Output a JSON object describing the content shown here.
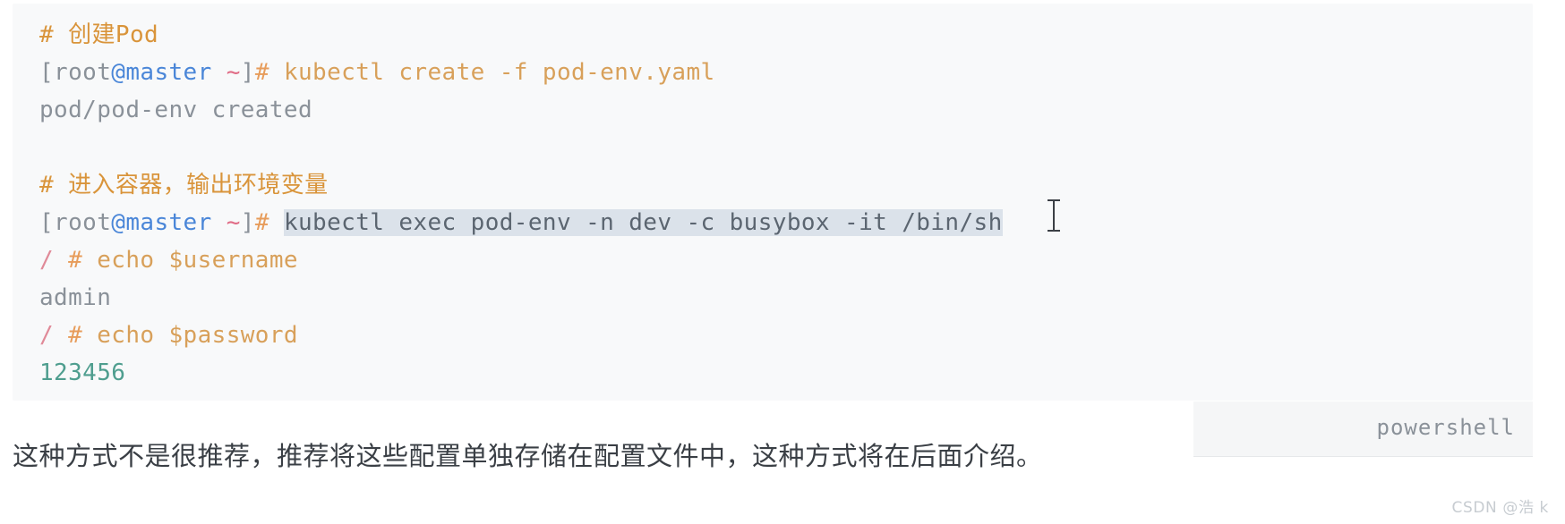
{
  "code_block": {
    "language_label": "powershell",
    "lines": [
      {
        "id": "comment-create-pod",
        "tokens": [
          {
            "kind": "comment",
            "text": "# 创建Pod"
          }
        ]
      },
      {
        "id": "cmd-create",
        "tokens": [
          {
            "kind": "bracket",
            "text": "[root"
          },
          {
            "kind": "host",
            "text": "@master"
          },
          {
            "kind": "bracket",
            "text": " "
          },
          {
            "kind": "tilde",
            "text": "~"
          },
          {
            "kind": "bracket",
            "text": "]"
          },
          {
            "kind": "hash",
            "text": "# "
          },
          {
            "kind": "cmd",
            "text": "kubectl create -f pod-env.yaml"
          }
        ]
      },
      {
        "id": "out-created",
        "tokens": [
          {
            "kind": "out",
            "text": "pod/pod-env created"
          }
        ]
      },
      {
        "id": "blank-1",
        "tokens": []
      },
      {
        "id": "comment-enter-container",
        "tokens": [
          {
            "kind": "comment",
            "text": "# 进入容器，输出环境变量"
          }
        ]
      },
      {
        "id": "cmd-exec",
        "tokens": [
          {
            "kind": "bracket",
            "text": "[root"
          },
          {
            "kind": "host",
            "text": "@master"
          },
          {
            "kind": "bracket",
            "text": " "
          },
          {
            "kind": "tilde",
            "text": "~"
          },
          {
            "kind": "bracket",
            "text": "]"
          },
          {
            "kind": "hash",
            "text": "# "
          },
          {
            "kind": "selected",
            "text": "kubectl exec pod-env -n dev -c busybox -it /bin/sh"
          }
        ]
      },
      {
        "id": "cmd-echo-username",
        "tokens": [
          {
            "kind": "slash",
            "text": "/ "
          },
          {
            "kind": "hash",
            "text": "# "
          },
          {
            "kind": "cmd",
            "text": "echo $username"
          }
        ]
      },
      {
        "id": "out-admin",
        "tokens": [
          {
            "kind": "out",
            "text": "admin"
          }
        ]
      },
      {
        "id": "cmd-echo-password",
        "tokens": [
          {
            "kind": "slash",
            "text": "/ "
          },
          {
            "kind": "hash",
            "text": "# "
          },
          {
            "kind": "cmd",
            "text": "echo $password"
          }
        ]
      },
      {
        "id": "out-123456",
        "tokens": [
          {
            "kind": "num",
            "text": "123456"
          }
        ]
      }
    ]
  },
  "paragraph": {
    "text": "这种方式不是很推荐，推荐将这些配置单独存储在配置文件中，这种方式将在后面介绍。"
  },
  "watermark": {
    "text": "CSDN @浩 k"
  },
  "colors": {
    "code_background": "#f8f9fa",
    "selection_background": "#dbe2ea",
    "comment": "#d9943a",
    "host": "#4a86d8",
    "command": "#d8a05a",
    "output": "#8a9199",
    "number": "#4f9e8f",
    "paragraph_text": "#3a3f45",
    "watermark": "#c7ccd1"
  }
}
